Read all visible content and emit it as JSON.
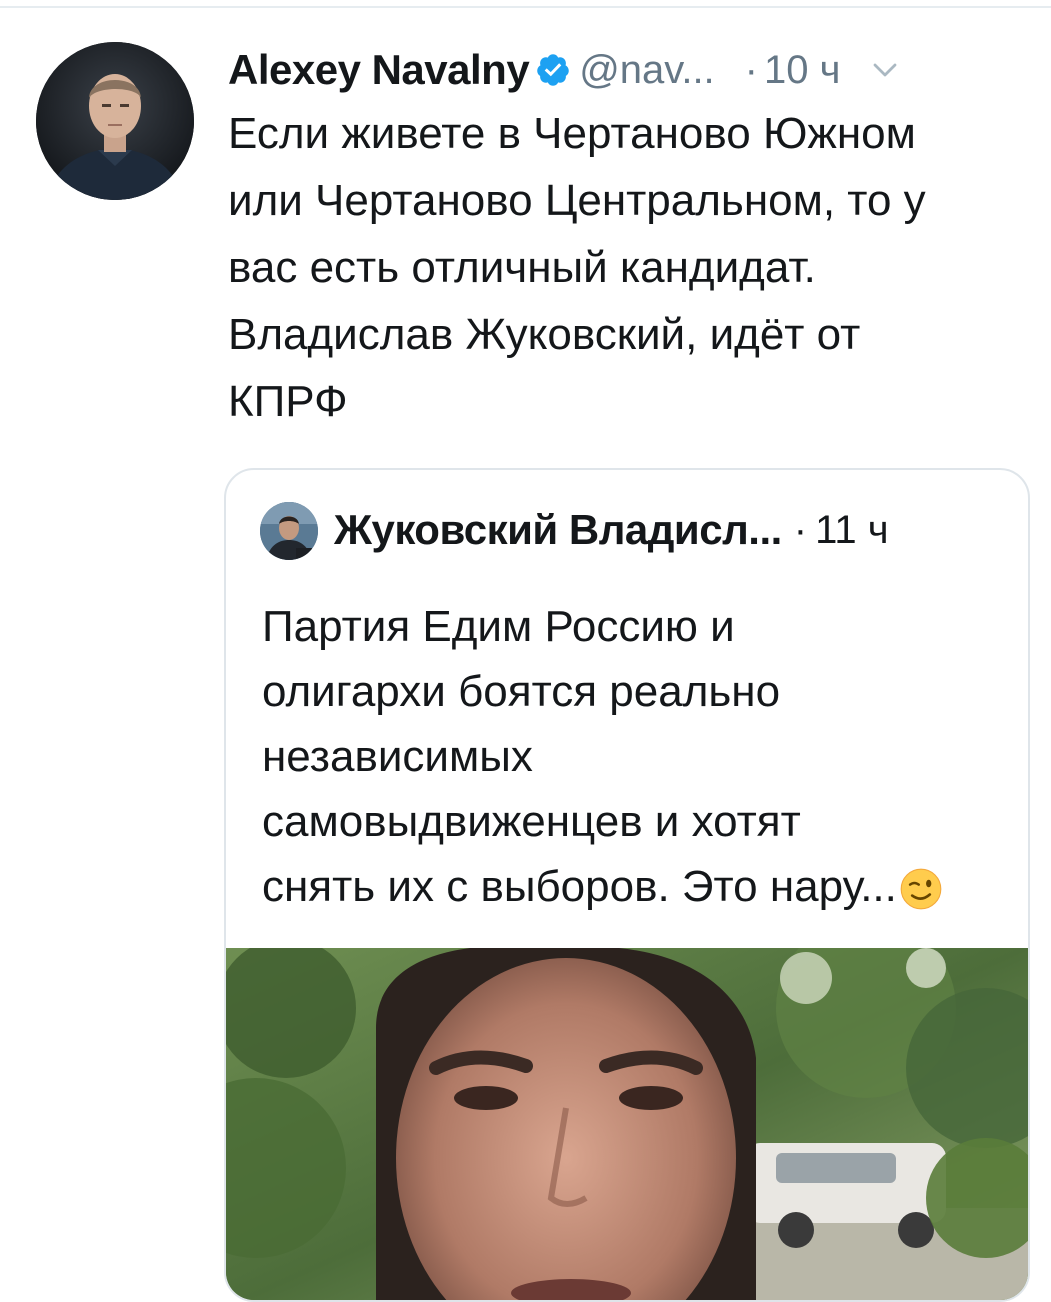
{
  "tweet": {
    "author_name": "Alexey Navalny",
    "handle": "@nav...",
    "separator": "·",
    "time": "10 ч",
    "lines": [
      "Если живете в Чертаново Южном",
      "или Чертаново Центральном, то у",
      "вас есть отличный кандидат.",
      "Владислав Жуковский, идёт от",
      "КПРФ"
    ],
    "icons": {
      "verified": "verified-badge-icon",
      "menu": "chevron-down-icon"
    }
  },
  "quote": {
    "author_name": "Жуковский Владисл...",
    "separator": "·",
    "time": "11 ч",
    "lines": [
      "Партия Едим Россию и",
      "олигархи боятся реально",
      "независимых",
      "самовыдвиженцев и хотят",
      "снять их с выборов. Это нару..."
    ],
    "emoji": "winking-face-emoji"
  },
  "colors": {
    "text": "#14171a",
    "secondary": "#657786",
    "verified": "#1da1f2",
    "border": "#dfe5ea"
  }
}
